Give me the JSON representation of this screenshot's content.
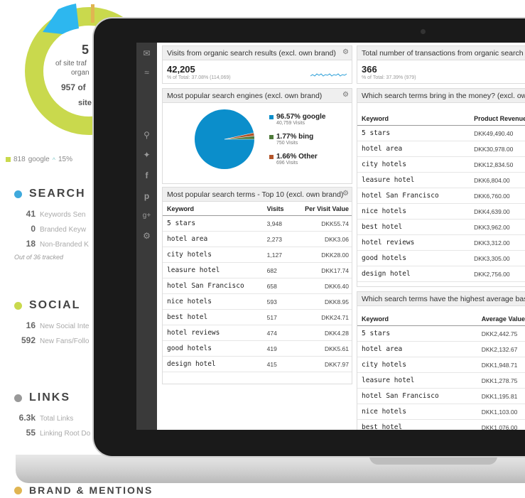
{
  "background": {
    "donut": {
      "big": "5",
      "line1": "of site traf",
      "line2": "organ",
      "line3": "957 of",
      "line4": "site",
      "legend_count": "818",
      "legend_source": "google",
      "legend_change": "15%"
    },
    "sections": [
      {
        "title": "SEARCH",
        "color": "#3fa9dc",
        "metrics": [
          {
            "value": "41",
            "label": "Keywords Sen"
          },
          {
            "value": "0",
            "label": "Branded Keyw"
          },
          {
            "value": "18",
            "label": "Non-Branded K"
          }
        ],
        "note": "Out of 36 tracked"
      },
      {
        "title": "SOCIAL",
        "color": "#c9d94d",
        "metrics": [
          {
            "value": "16",
            "label": "New Social Inte"
          },
          {
            "value": "592",
            "label": "New Fans/Follo"
          }
        ]
      },
      {
        "title": "LINKS",
        "color": "#999999",
        "metrics": [
          {
            "value": "6.3k",
            "label": "Total Links"
          },
          {
            "value": "55",
            "label": "Linking Root Do"
          }
        ]
      },
      {
        "title": "BRAND & MENTIONS",
        "color": "#e0b552",
        "metrics": []
      }
    ]
  },
  "sidebar_icons": [
    "mail-icon",
    "rss-icon",
    "search-icon",
    "twitter-icon",
    "facebook-icon",
    "pinterest-icon",
    "google-plus-icon",
    "settings-icon"
  ],
  "widgets": {
    "visits": {
      "title": "Visits from organic search results (excl. own brand)",
      "value": "42,205",
      "sub": "% of Total: 37.08% (114,069)"
    },
    "transactions": {
      "title": "Total number of transactions from organic search (e",
      "value": "366",
      "sub": "% of Total: 37.39% (979)"
    },
    "engines": {
      "title": "Most popular search engines (excl. own brand)",
      "items": [
        {
          "label": "96.57% google",
          "sub": "40,759 Visits",
          "color": "#0b8ecb"
        },
        {
          "label": "1.77% bing",
          "sub": "750 Visits",
          "color": "#4e7a3a"
        },
        {
          "label": "1.66% Other",
          "sub": "696 Visits",
          "color": "#b3552a"
        }
      ]
    },
    "terms": {
      "title": "Most popular search terms - Top 10 (excl. own brand)",
      "headers": [
        "Keyword",
        "Visits",
        "Per Visit Value"
      ],
      "rows": [
        [
          "5 stars",
          "3,948",
          "DKK55.74"
        ],
        [
          "hotel area",
          "2,273",
          "DKK3.06"
        ],
        [
          "city hotels",
          "1,127",
          "DKK28.00"
        ],
        [
          "leasure hotel",
          "682",
          "DKK17.74"
        ],
        [
          "hotel San Francisco",
          "658",
          "DKK6.40"
        ],
        [
          "nice hotels",
          "593",
          "DKK8.95"
        ],
        [
          "best hotel",
          "517",
          "DKK24.71"
        ],
        [
          "hotel reviews",
          "474",
          "DKK4.28"
        ],
        [
          "good hotels",
          "419",
          "DKK5.61"
        ],
        [
          "design hotel",
          "415",
          "DKK7.97"
        ]
      ]
    },
    "money": {
      "title": "Which search terms bring in the money? (excl. own b",
      "headers": [
        "Keyword",
        "Product Revenue"
      ],
      "rows": [
        [
          "5 stars",
          "DKK49,490.40"
        ],
        [
          "hotel area",
          "DKK30,978.00"
        ],
        [
          "city hotels",
          "DKK12,834.50"
        ],
        [
          "leasure hotel",
          "DKK6,804.00"
        ],
        [
          "hotel San Francisco",
          "DKK6,760.00"
        ],
        [
          "nice hotels",
          "DKK4,639.00"
        ],
        [
          "best hotel",
          "DKK3,962.00"
        ],
        [
          "hotel reviews",
          "DKK3,312.00"
        ],
        [
          "good hotels",
          "DKK3,305.00"
        ],
        [
          "design hotel",
          "DKK2,756.00"
        ]
      ]
    },
    "basket": {
      "title": "Which search terms have the highest average basket",
      "headers": [
        "Keyword",
        "Average Value"
      ],
      "rows": [
        [
          "5 stars",
          "DKK2,442.75"
        ],
        [
          "hotel area",
          "DKK2,132.67"
        ],
        [
          "city hotels",
          "DKK1,948.71"
        ],
        [
          "leasure hotel",
          "DKK1,278.75"
        ],
        [
          "hotel San Francisco",
          "DKK1,195.81"
        ],
        [
          "nice hotels",
          "DKK1,103.00"
        ],
        [
          "best hotel",
          "DKK1,076.00"
        ]
      ]
    }
  }
}
